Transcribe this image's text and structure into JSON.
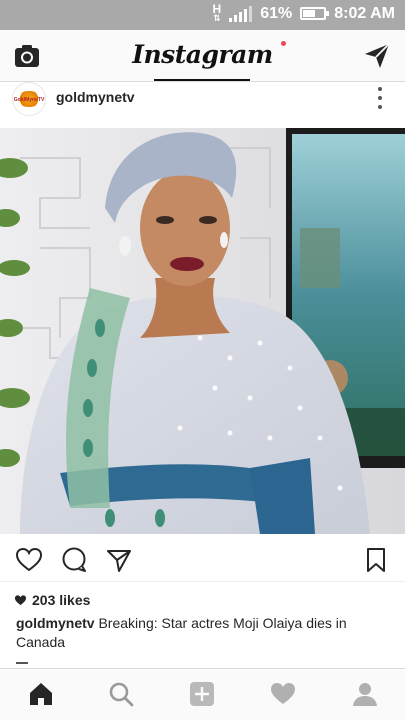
{
  "status_bar": {
    "network_label": "H",
    "battery_percent": "61%",
    "battery_level": 0.61,
    "time": "8:02 AM"
  },
  "app_bar": {
    "title": "Instagram",
    "left_icon": "camera-icon",
    "right_icon": "direct-send-icon"
  },
  "post": {
    "username": "goldmynetv",
    "avatar_text": "GoldMyneTV",
    "more_icon": "more-vertical-icon",
    "image_subject": "photo",
    "likes": "203 likes",
    "caption_username": "goldmynetv",
    "caption_text": "Breaking: Star actres Moji Olaiya dies in Canada"
  },
  "actions": {
    "like_icon": "heart-icon",
    "comment_icon": "comment-icon",
    "share_icon": "share-icon",
    "save_icon": "bookmark-icon"
  },
  "bottom_nav": {
    "items": [
      "home-icon",
      "search-icon",
      "add-post-icon",
      "activity-heart-icon",
      "profile-icon"
    ],
    "active": "home-icon",
    "activity_indicator_color": "#ed4956"
  }
}
